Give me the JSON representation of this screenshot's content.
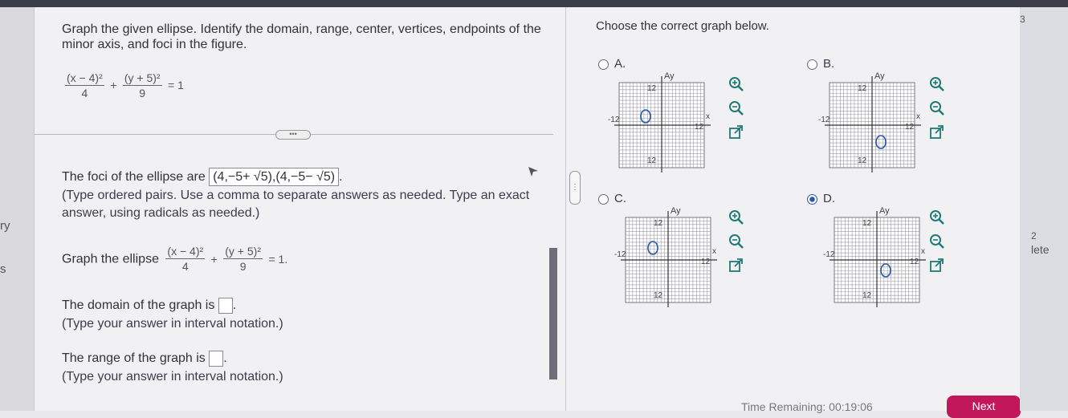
{
  "window": {
    "topbar_color": "#3b3d48",
    "accent": "#2b58a8",
    "next_color": "#c2185b"
  },
  "left_gutter": {
    "items": [
      "ry",
      "s"
    ]
  },
  "question": {
    "instructions": "Graph the given ellipse. Identify the domain, range, center, vertices, endpoints of the minor axis, and foci in the figure.",
    "equation": {
      "num1": "(x − 4)²",
      "den1": "4",
      "plus": "+",
      "num2": "(y + 5)²",
      "den2": "9",
      "eq": "= 1"
    },
    "expand_label": "•••",
    "foci_prefix": "The foci of the ellipse are",
    "foci_answer": "(4,−5+ √5),(4,−5− √5)",
    "foci_hint": "(Type ordered pairs. Use a comma to separate answers as needed. Type an exact answer, using radicals as needed.)",
    "graph_prompt": "Graph the ellipse",
    "graph_eq": {
      "num1": "(x − 4)²",
      "den1": "4",
      "plus": "+",
      "num2": "(y + 5)²",
      "den2": "9",
      "eq": "= 1."
    },
    "domain_prefix": "The domain of the graph is",
    "domain_hint": "(Type your answer in interval notation.)",
    "range_prefix": "The range of the graph is",
    "range_hint": "(Type your answer in interval notation.)",
    "period": "."
  },
  "divider_handle": "⋮",
  "choices": {
    "prompt": "Choose the correct graph below.",
    "options": [
      {
        "label": "A.",
        "selected": false,
        "axis_y": "Ay",
        "axis_x": "x",
        "tick_top": "12",
        "tick_left": "-12",
        "tick_right": "12",
        "tick_bottom": "12"
      },
      {
        "label": "B.",
        "selected": false,
        "axis_y": "Ay",
        "axis_x": "x",
        "tick_top": "12",
        "tick_left": "-12",
        "tick_right": "12",
        "tick_bottom": "12"
      },
      {
        "label": "C.",
        "selected": false,
        "axis_y": "Ay",
        "axis_x": "x",
        "tick_top": "12",
        "tick_left": "-12",
        "tick_right": "12",
        "tick_bottom": "12"
      },
      {
        "label": "D.",
        "selected": true,
        "axis_y": "Ay",
        "axis_x": "x",
        "tick_top": "12",
        "tick_left": "-12",
        "tick_right": "12",
        "tick_bottom": "12"
      }
    ],
    "tools": [
      "zoom-in-icon",
      "zoom-out-icon",
      "open-external-icon"
    ]
  },
  "footer": {
    "timer_text": "Time Remaining: 00:19:06",
    "next_label": "Next"
  },
  "right_gutter": {
    "text_top": "3",
    "text_mid": "2",
    "text_label": "lete"
  }
}
